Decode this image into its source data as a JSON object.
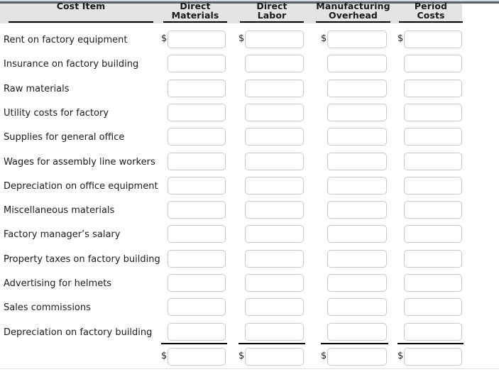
{
  "table": {
    "columns": [
      {
        "key": "cost_item",
        "line1": "",
        "line2": "Cost Item"
      },
      {
        "key": "direct_materials",
        "line1": "Direct",
        "line2": "Materials"
      },
      {
        "key": "direct_labor",
        "line1": "Direct",
        "line2": "Labor"
      },
      {
        "key": "mfg_overhead",
        "line1": "Manufacturing",
        "line2": "Overhead"
      },
      {
        "key": "period_costs",
        "line1": "Period",
        "line2": "Costs"
      }
    ],
    "currency_symbol": "$",
    "rows": [
      {
        "label": "Rent on factory equipment",
        "direct_materials": "",
        "direct_labor": "",
        "mfg_overhead": "",
        "period_costs": ""
      },
      {
        "label": "Insurance on factory building",
        "direct_materials": "",
        "direct_labor": "",
        "mfg_overhead": "",
        "period_costs": ""
      },
      {
        "label": "Raw materials",
        "direct_materials": "",
        "direct_labor": "",
        "mfg_overhead": "",
        "period_costs": ""
      },
      {
        "label": "Utility costs for factory",
        "direct_materials": "",
        "direct_labor": "",
        "mfg_overhead": "",
        "period_costs": ""
      },
      {
        "label": "Supplies for general office",
        "direct_materials": "",
        "direct_labor": "",
        "mfg_overhead": "",
        "period_costs": ""
      },
      {
        "label": "Wages for assembly line workers",
        "direct_materials": "",
        "direct_labor": "",
        "mfg_overhead": "",
        "period_costs": ""
      },
      {
        "label": "Depreciation on office equipment",
        "direct_materials": "",
        "direct_labor": "",
        "mfg_overhead": "",
        "period_costs": ""
      },
      {
        "label": "Miscellaneous materials",
        "direct_materials": "",
        "direct_labor": "",
        "mfg_overhead": "",
        "period_costs": ""
      },
      {
        "label": "Factory manager’s salary",
        "direct_materials": "",
        "direct_labor": "",
        "mfg_overhead": "",
        "period_costs": ""
      },
      {
        "label": "Property taxes on factory building",
        "direct_materials": "",
        "direct_labor": "",
        "mfg_overhead": "",
        "period_costs": ""
      },
      {
        "label": "Advertising for helmets",
        "direct_materials": "",
        "direct_labor": "",
        "mfg_overhead": "",
        "period_costs": ""
      },
      {
        "label": "Sales commissions",
        "direct_materials": "",
        "direct_labor": "",
        "mfg_overhead": "",
        "period_costs": ""
      },
      {
        "label": "Depreciation on factory building",
        "direct_materials": "",
        "direct_labor": "",
        "mfg_overhead": "",
        "period_costs": ""
      }
    ],
    "total_row": {
      "label": "",
      "direct_materials": "",
      "direct_labor": "",
      "mfg_overhead": "",
      "period_costs": ""
    }
  },
  "colors": {
    "header_background": "#e4e4e4",
    "header_rule": "#000000",
    "input_border": "#c9c9c9",
    "page_background": "#ffffff",
    "top_bar": "#5f5f5f"
  }
}
